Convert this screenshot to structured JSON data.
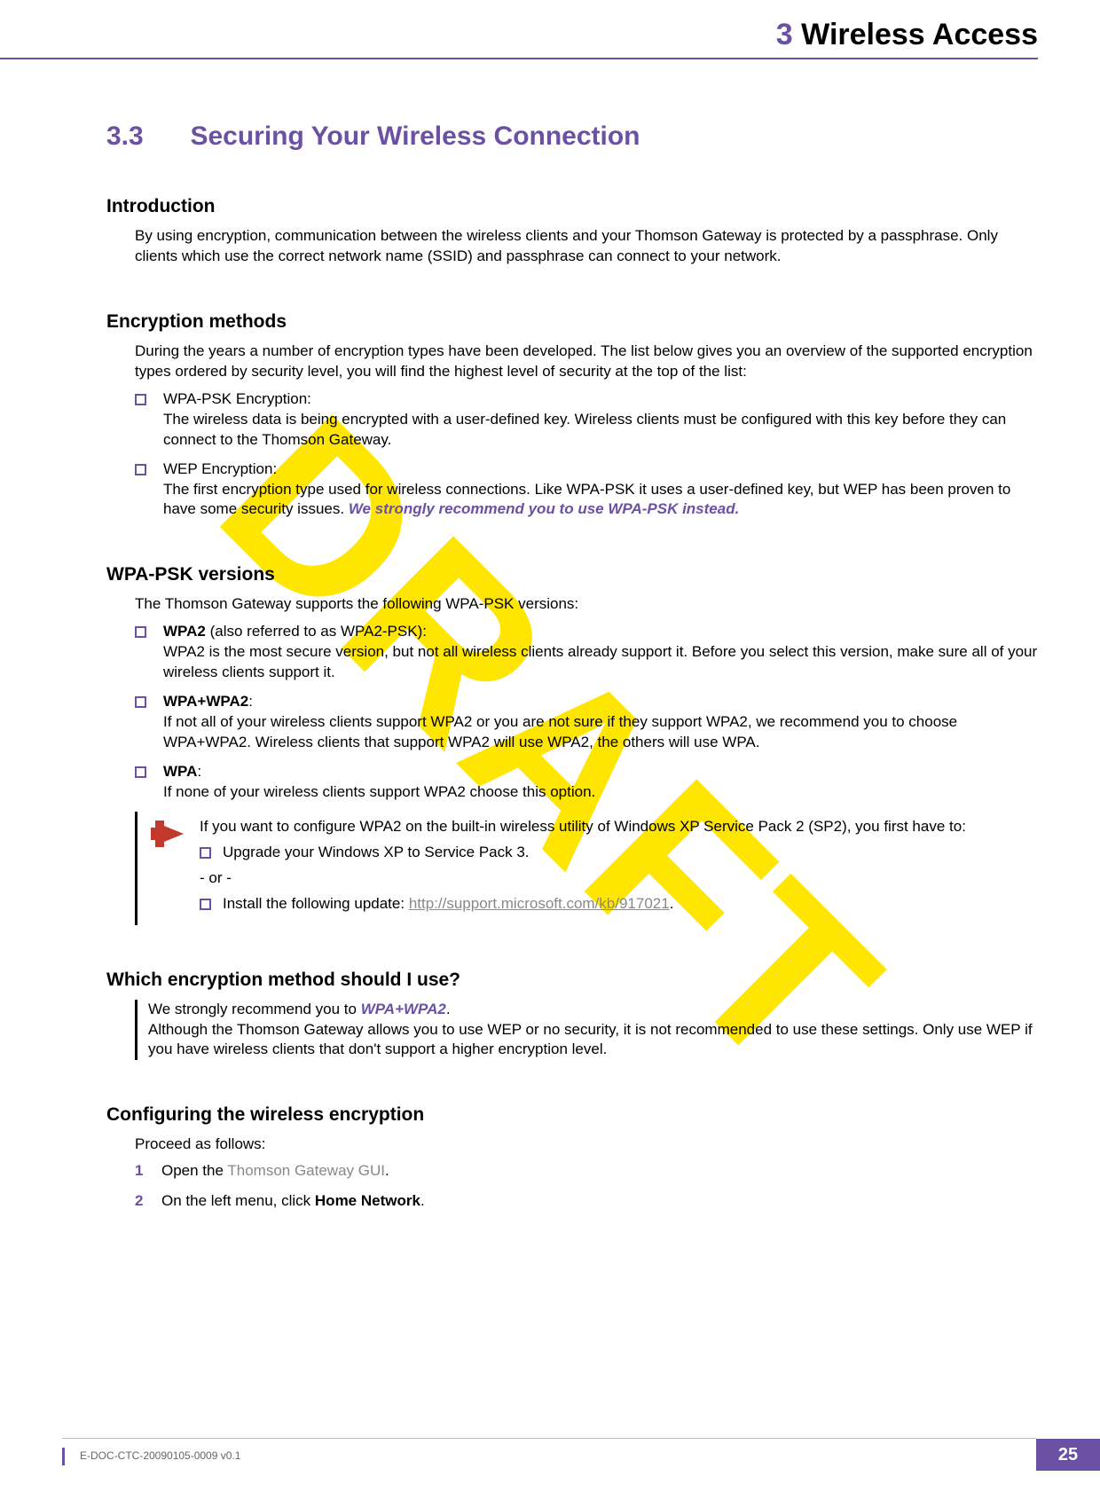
{
  "watermark": "DRAFT",
  "header": {
    "chapter_num": "3",
    "chapter_title": "Wireless Access"
  },
  "section": {
    "num": "3.3",
    "title": "Securing Your Wireless Connection"
  },
  "intro": {
    "heading": "Introduction",
    "text": "By using encryption, communication between the wireless clients and your Thomson Gateway is protected by a passphrase. Only clients which use the correct network name (SSID) and passphrase can connect to your network."
  },
  "enc_methods": {
    "heading": "Encryption methods",
    "intro": "During the years a number of encryption types have been developed. The list below gives you an overview of the supported encryption types ordered by security level, you will find the highest level of security at the top of the list:",
    "items": [
      {
        "title": "WPA-PSK Encryption:",
        "body": "The wireless data is being encrypted with a user-defined key. Wireless clients must be configured with this key before they can connect to the Thomson Gateway."
      },
      {
        "title": "WEP Encryption:",
        "body": "The first encryption type used for wireless connections. Like WPA-PSK it uses a user-defined key, but WEP has been proven to have some security issues. ",
        "emph": "We strongly recommend you to use WPA-PSK instead."
      }
    ]
  },
  "wpa_versions": {
    "heading": "WPA-PSK versions",
    "intro": "The Thomson Gateway supports the following WPA-PSK versions:",
    "items": [
      {
        "name": "WPA2",
        "name_suffix": " (also referred to as WPA2-PSK):",
        "body": "WPA2 is the most secure version, but not all wireless clients already support it. Before you select this version, make sure all of your wireless clients support it."
      },
      {
        "name": "WPA+WPA2",
        "name_suffix": ":",
        "body": "If not all of your wireless clients support WPA2 or you are not sure if they support WPA2, we recommend you to choose WPA+WPA2. Wireless clients that support WPA2 will use WPA2, the others will use WPA."
      },
      {
        "name": "WPA",
        "name_suffix": ":",
        "body": "If none of your wireless clients support WPA2 choose this option."
      }
    ],
    "note": {
      "line1": "If you want to configure WPA2 on the built-in wireless utility of Windows XP Service Pack 2 (SP2), you first have to:",
      "bullet1": "Upgrade your Windows XP to Service Pack 3.",
      "or": "- or -",
      "bullet2_pre": "Install the following update: ",
      "bullet2_link": "http://support.microsoft.com/kb/917021",
      "bullet2_post": "."
    }
  },
  "which": {
    "heading": "Which encryption method should I use?",
    "line1_pre": "We strongly recommend you to ",
    "line1_link": "WPA+WPA2",
    "line1_post": ".",
    "line2": "Although the Thomson Gateway allows you to use WEP or no security, it is not recommended to use these settings. Only use WEP if you have wireless clients that don't support a higher encryption level."
  },
  "config": {
    "heading": "Configuring the wireless encryption",
    "intro": "Proceed as follows:",
    "steps": [
      {
        "pre": "Open the ",
        "link": "Thomson Gateway GUI",
        "post": "."
      },
      {
        "pre": "On the left menu, click ",
        "bold": "Home Network",
        "post": "."
      }
    ]
  },
  "footer": {
    "doc_id": "E-DOC-CTC-20090105-0009 v0.1",
    "page_num": "25"
  }
}
